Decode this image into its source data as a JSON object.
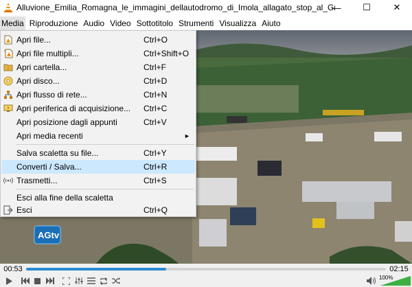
{
  "window": {
    "title": "Alluvione_Emilia_Romagna_le_immagini_dellautodromo_di_Imola_allagato_stop_al_Gran...",
    "minimize": "—",
    "maximize": "☐",
    "close": "✕"
  },
  "menubar": {
    "items": [
      "Media",
      "Riproduzione",
      "Audio",
      "Video",
      "Sottotitolo",
      "Strumenti",
      "Visualizza",
      "Aiuto"
    ]
  },
  "media_menu": {
    "items": [
      {
        "label": "Apri file...",
        "shortcut": "Ctrl+O",
        "icon": "file-icon"
      },
      {
        "label": "Apri file multipli...",
        "shortcut": "Ctrl+Shift+O",
        "icon": "files-icon"
      },
      {
        "label": "Apri cartella...",
        "shortcut": "Ctrl+F",
        "icon": "folder-icon"
      },
      {
        "label": "Apri disco...",
        "shortcut": "Ctrl+D",
        "icon": "disc-icon"
      },
      {
        "label": "Apri flusso di rete...",
        "shortcut": "Ctrl+N",
        "icon": "network-icon"
      },
      {
        "label": "Apri periferica di acquisizione...",
        "shortcut": "Ctrl+C",
        "icon": "capture-icon"
      },
      {
        "label": "Apri posizione dagli appunti",
        "shortcut": "Ctrl+V",
        "icon": ""
      },
      {
        "label": "Apri media recenti",
        "shortcut": "",
        "icon": "",
        "submenu": "►"
      },
      {
        "label": "Salva scaletta su file...",
        "shortcut": "Ctrl+Y",
        "icon": ""
      },
      {
        "label": "Converti / Salva...",
        "shortcut": "Ctrl+R",
        "icon": "",
        "highlight": true
      },
      {
        "label": "Trasmetti...",
        "shortcut": "Ctrl+S",
        "icon": "stream-icon"
      },
      {
        "label": "Esci alla fine della scaletta",
        "shortcut": "",
        "icon": ""
      },
      {
        "label": "Esci",
        "shortcut": "Ctrl+Q",
        "icon": "exit-icon"
      }
    ]
  },
  "playback": {
    "current_time": "00:53",
    "total_time": "02:15",
    "progress": 0.39,
    "volume_label": "100%",
    "volume": 1.0
  },
  "overlay_logo": "AGtv",
  "colors": {
    "accent": "#2a8ad4",
    "highlight": "#cce8ff",
    "volume_green": "#3cb043"
  }
}
